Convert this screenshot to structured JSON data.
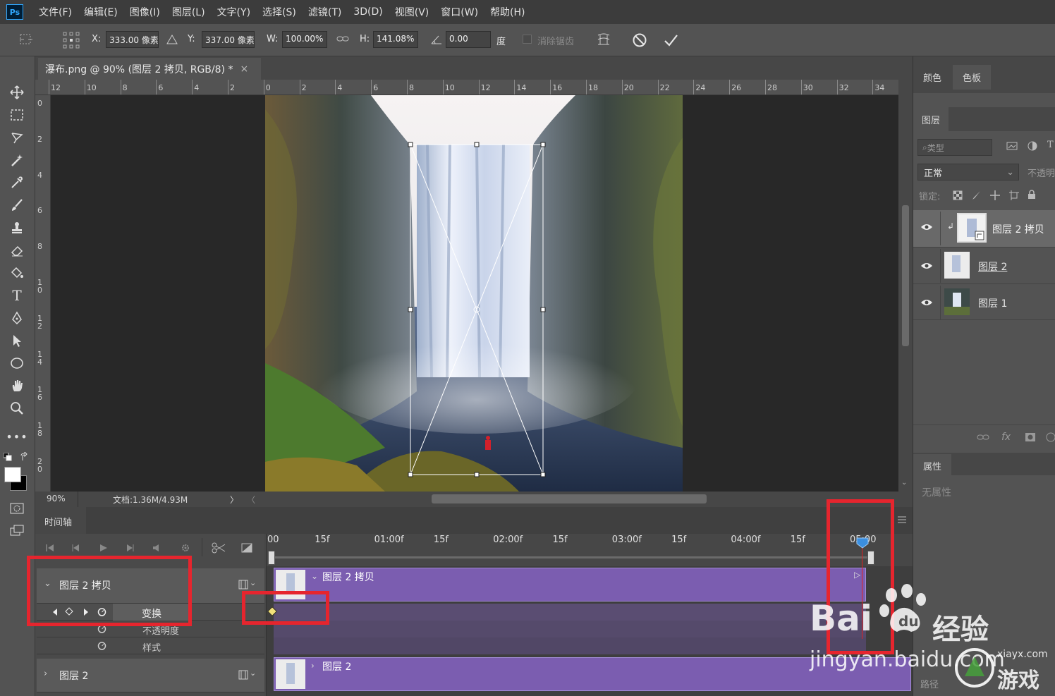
{
  "app": {
    "logo": "Ps"
  },
  "menu": [
    "文件(F)",
    "编辑(E)",
    "图像(I)",
    "图层(L)",
    "文字(Y)",
    "选择(S)",
    "滤镜(T)",
    "3D(D)",
    "视图(V)",
    "窗口(W)",
    "帮助(H)"
  ],
  "options": {
    "x_label": "X:",
    "x_value": "333.00 像素",
    "y_label": "Y:",
    "y_value": "337.00 像素",
    "w_label": "W:",
    "w_value": "100.00%",
    "h_label": "H:",
    "h_value": "141.08%",
    "angle_value": "0.00",
    "angle_unit": "度",
    "antialias_label": "消除锯齿"
  },
  "document": {
    "tab_title": "瀑布.png @ 90% (图层 2 拷贝, RGB/8) *",
    "close_glyph": "×"
  },
  "ruler_h": [
    "12",
    "10",
    "8",
    "6",
    "4",
    "2",
    "0",
    "2",
    "4",
    "6",
    "8",
    "10",
    "12",
    "14",
    "16",
    "18",
    "20",
    "22",
    "24",
    "26",
    "28",
    "30",
    "32",
    "34"
  ],
  "ruler_v": [
    "0",
    "2",
    "4",
    "6",
    "8",
    "1 0",
    "1 2",
    "1 4",
    "1 6",
    "1 8",
    "2 0"
  ],
  "status": {
    "zoom": "90%",
    "doc_info": "文档:1.36M/4.93M",
    "arrow_right": "〉",
    "arrow_left": "〈"
  },
  "panels": {
    "top_tabs": [
      "颜色",
      "色板"
    ],
    "layers_tab": "图层",
    "filter_placeholder": "类型",
    "blend_mode": "正常",
    "opacity_label": "不透明",
    "lock_label": "锁定:",
    "layers": [
      {
        "name": "图层 2 拷贝",
        "selected": true
      },
      {
        "name": "图层 2",
        "selected": false
      },
      {
        "name": "图层 1",
        "selected": false
      }
    ],
    "properties_tab": "属性",
    "no_properties": "无属性",
    "path_label": "路径"
  },
  "timeline": {
    "tab": "时间轴",
    "time_labels": [
      "00",
      "15f",
      "01:00f",
      "15f",
      "02:00f",
      "15f",
      "03:00f",
      "15f",
      "04:00f",
      "15f",
      "05:00"
    ],
    "tracks": [
      {
        "name": "图层 2 拷贝",
        "clip_label": "图层 2 拷贝",
        "expanded": true
      },
      {
        "name": "图层 2",
        "clip_label": "图层 2",
        "expanded": false
      }
    ],
    "properties": [
      "变换",
      "不透明度",
      "样式"
    ]
  },
  "watermark": {
    "brand": "Bai",
    "brand2": "经验",
    "url": "jingyan.baidu.com",
    "site": "xiayx.com",
    "game": "游戏"
  },
  "colors": {
    "accent": "#7b5db0",
    "highlight_box": "#e6252e",
    "playhead": "#3b8fe0"
  }
}
